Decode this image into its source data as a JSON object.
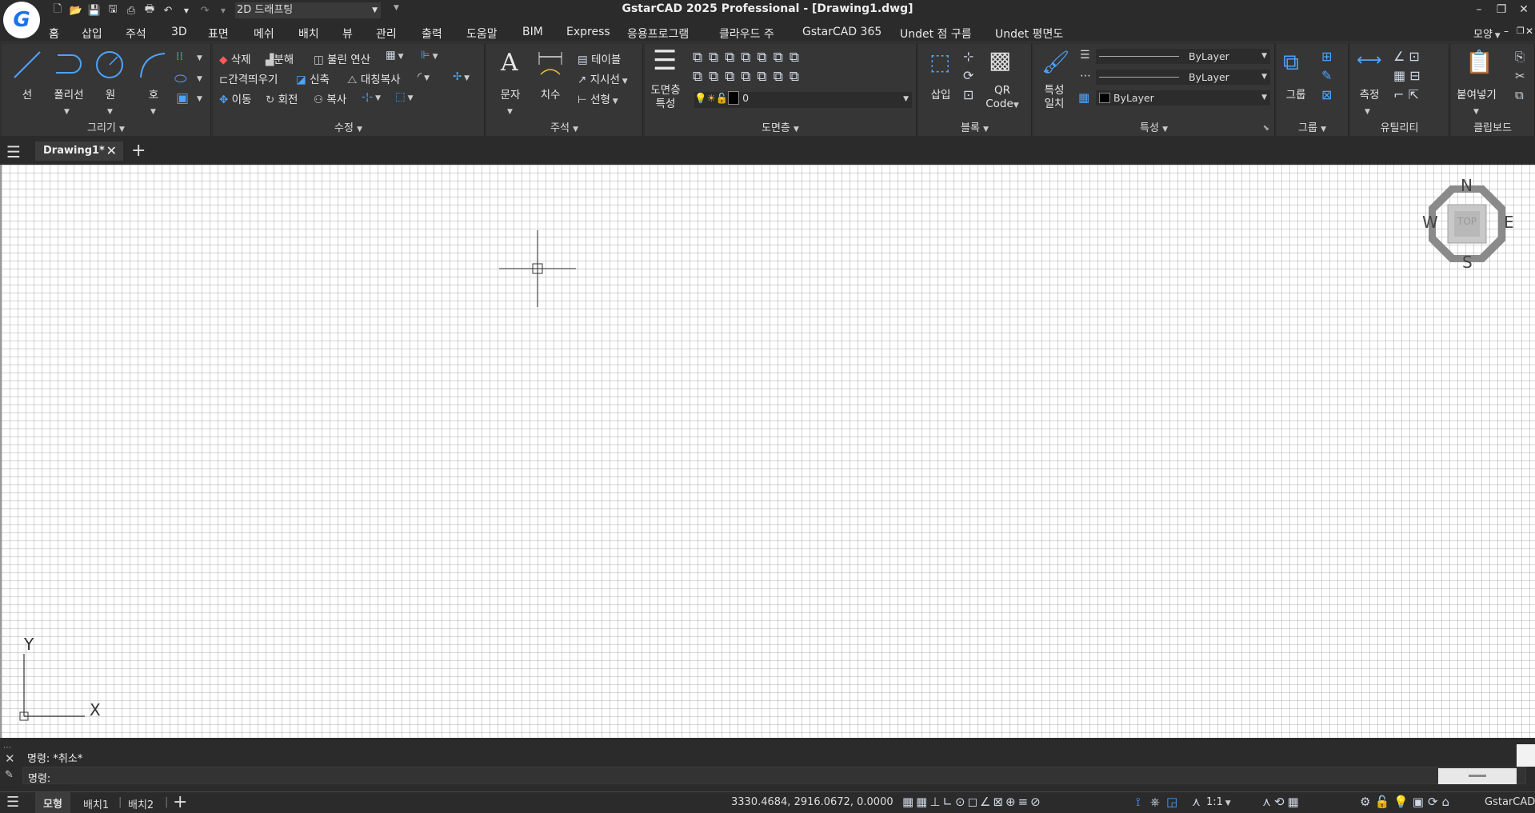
{
  "app": {
    "logo_letter": "G",
    "title": "GstarCAD 2025 Professional - [Drawing1.dwg]",
    "workspace": "2D 드래프팅",
    "accent": "#1a73e8"
  },
  "window_controls": {
    "minimize": "–",
    "restore": "❐",
    "close": "✕"
  },
  "menu": [
    "홈",
    "삽입",
    "주석",
    "3D",
    "표면",
    "메쉬",
    "배치",
    "뷰",
    "관리",
    "출력",
    "도움말",
    "BIM",
    "Express",
    "응용프로그램",
    "클라우드 주",
    "GstarCAD 365",
    "Undet 점 구름",
    "Undet 평면도"
  ],
  "menu_right": {
    "label": "모양"
  },
  "ribbon": {
    "draw": {
      "title": "그리기",
      "line": "선",
      "polyline": "폴리선",
      "circle": "원",
      "arc": "호"
    },
    "modify": {
      "title": "수정",
      "erase": "삭제",
      "explode": "분해",
      "boolean": "불린 연산",
      "offset": "간격띄우기",
      "stretch": "신축",
      "mirror": "대칭복사",
      "move": "이동",
      "rotate": "회전",
      "copy": "복사"
    },
    "annotation": {
      "title": "주석",
      "text": "문자",
      "dim": "치수",
      "table": "테이블",
      "leader": "지시선",
      "linear": "선형"
    },
    "layers": {
      "title": "도면층",
      "props_line1": "도면층",
      "props_line2": "특성",
      "current_layer": "0"
    },
    "block": {
      "title": "블록",
      "insert": "삽입",
      "qr_line1": "QR",
      "qr_line2": "Code"
    },
    "properties": {
      "title": "특성",
      "match_line1": "특성",
      "match_line2": "일치",
      "linetype1": "ByLayer",
      "linetype2": "ByLayer",
      "color": "ByLayer"
    },
    "groups": {
      "title": "그룹",
      "group": "그룹"
    },
    "utilities": {
      "title": "유틸리티",
      "measure": "측정"
    },
    "clipboard": {
      "title": "클립보드",
      "paste": "붙여넣기"
    }
  },
  "tabs": {
    "active": "Drawing1*"
  },
  "viewcube": {
    "north": "N",
    "south": "S",
    "east": "E",
    "west": "W",
    "face": "TOP"
  },
  "ucs": {
    "x": "X",
    "y": "Y"
  },
  "command": {
    "history": "명령: *취소*",
    "prompt": "명령:"
  },
  "status": {
    "model": "모형",
    "layout1": "배치1",
    "layout2": "배치2",
    "coords": "3330.4684, 2916.0672, 0.0000",
    "scale": "1:1",
    "app": "GstarCAD"
  }
}
